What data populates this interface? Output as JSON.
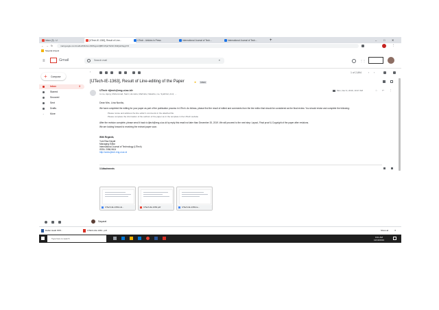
{
  "browser": {
    "tabs": [
      {
        "label": "Inbox (3) - U"
      },
      {
        "label": "[IJTech-IE-1363], Result of Line..."
      },
      {
        "label": "IJTech - Articles in Press"
      },
      {
        "label": "International Journal of Tech..."
      },
      {
        "label": "International Journal of Tech..."
      }
    ],
    "new_tab_label": "+",
    "address": "mail.google.com/mail/u/0/#inbox/FMfcgxwKjBPnWpdTHlhrCRdQwFbqgVrfz",
    "bookmark_label": "Sayarat Ariyani",
    "window_controls": [
      "–",
      "□",
      "✕"
    ]
  },
  "gmail": {
    "brand": "Gmail",
    "menu_icon": "hamburger-icon",
    "search_placeholder": "Search mail",
    "compose_label": "Compose",
    "nav": [
      {
        "label": "Inbox",
        "count": "3",
        "icon": "inbox-icon"
      },
      {
        "label": "Starred",
        "icon": "star-icon"
      },
      {
        "label": "Snoozed",
        "icon": "clock-icon"
      },
      {
        "label": "Sent",
        "icon": "send-icon"
      },
      {
        "label": "Drafts",
        "icon": "file-icon"
      },
      {
        "label": "More",
        "icon": "chevron-down-icon"
      }
    ],
    "pager": "1 of 2,894",
    "hangouts_user": "Sayarat"
  },
  "email": {
    "subject": "[IJTech-IE-1363], Result of Line-editing of the Paper",
    "label": "Inbox",
    "sender": "IJTech <ijtech@eng.ui.ac.id>",
    "recipients": "to me, Ajeng, Muhammad, Santi, Humaira, Marlinda, Natasha, me, Syafrizal, Amir, ...",
    "date": "Mon, Dec 9, 2019, 10:27 AM",
    "greeting": "Dear Mrs. Lina Novita,",
    "para1": "We have completed the editing for your paper as part of the publication process in IJTech. As follows, please find the result of edited and comments from the line editor that should be considered as the final review. You should revise and complete the following:",
    "bullets": [
      "Please revise and address the line editor's comments in the attached file",
      "Please complete the information of the authors of the paper as in the template in the IJTech website"
    ],
    "para2": "After the revision complete, please send it back to ijtech@eng.ui.ac.id by reply this email not later than December 20, 2019. We will proceed to the next step: Layout, Final proof & Copyright of the paper after revisions.",
    "para3": "We are looking forward to receiving the revised paper soon.",
    "signature": [
      "With Regards,",
      "Yuni Elsa Hayati",
      "Managing Editor",
      "International Journal of Technology (IJTech)",
      "ISSN: 2086-9614",
      "http://www.ijtech.eng.ui.ac.id"
    ],
    "attachments_heading": "3 Attachments",
    "attachments": [
      {
        "name": "IJTech-IE-1363-LE...",
        "color": "#4285f4"
      },
      {
        "name": "IJTech-IE-1363.pdf",
        "color": "#ea4335"
      },
      {
        "name": "IJTech-IE-1363-te...",
        "color": "#4285f4"
      }
    ]
  },
  "downloads": [
    {
      "name": "Daftar Hadir PPP...",
      "type": "docx"
    },
    {
      "name": "IJTECH-IE-1363...pdf",
      "type": "pdf"
    }
  ],
  "download_show_all": "Show all",
  "taskbar": {
    "search_placeholder": "Type here to search",
    "time": "9:01 AM",
    "date": "12/10/2019"
  },
  "colors": {
    "gmail_red": "#d93025",
    "accent_blue": "#1a73e8",
    "taskbar": "#1f1f1f"
  }
}
